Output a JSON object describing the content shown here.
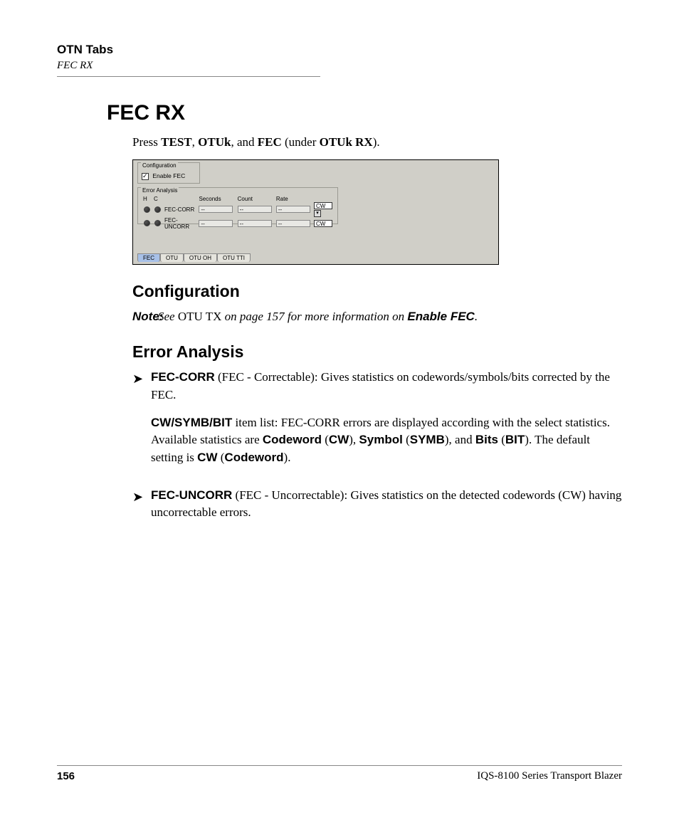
{
  "header": {
    "chapter": "OTN Tabs",
    "section": "FEC RX"
  },
  "title": "FEC RX",
  "intro": {
    "pre": "Press ",
    "k1": "TEST",
    "sep1": ", ",
    "k2": "OTUk",
    "sep2": ", and ",
    "k3": "FEC",
    "sep3": " (under ",
    "k4": "OTUk RX",
    "post": ")."
  },
  "ui": {
    "config_title": "Configuration",
    "enable_fec": "Enable FEC",
    "ea_title": "Error Analysis",
    "col_h": "H",
    "col_c": "C",
    "col_sec": "Seconds",
    "col_cnt": "Count",
    "col_rate": "Rate",
    "row1": "FEC-CORR",
    "row2": "FEC-UNCORR",
    "dash": "--",
    "cw": "CW",
    "drop": "▾",
    "tabs": [
      "FEC",
      "OTU",
      "OTU OH",
      "OTU TTI"
    ]
  },
  "sub_config": "Configuration",
  "note": {
    "label": "Note:",
    "t1": "See ",
    "ref": "OTU TX",
    "t2": " on page 157 for more information on ",
    "ref2": "Enable FEC",
    "t3": "."
  },
  "sub_error": "Error Analysis",
  "bullets": [
    {
      "p1": {
        "b1": "FEC-CORR",
        "t1": " (FEC - Correctable): Gives statistics on codewords/symbols/bits corrected by the FEC."
      },
      "p2": {
        "b1": "CW/SYMB/BIT",
        "t1": " item list: FEC-CORR errors are displayed according with the select statistics. Available statistics are ",
        "b2": "Codeword",
        "t2": " (",
        "b3": "CW",
        "t3": "), ",
        "b4": "Symbol",
        "t4": " (",
        "b5": "SYMB",
        "t5": "), and ",
        "b6": "Bits",
        "t6": " (",
        "b7": "BIT",
        "t7": "). The default setting is ",
        "b8": "CW",
        "t8": " (",
        "b9": "Codeword",
        "t9": ")."
      }
    },
    {
      "p1": {
        "b1": "FEC-UNCORR",
        "t1": " (FEC - Uncorrectable): Gives statistics on the detected codewords (CW) having uncorrectable errors."
      }
    }
  ],
  "footer": {
    "page": "156",
    "product": "IQS-8100 Series Transport Blazer"
  }
}
